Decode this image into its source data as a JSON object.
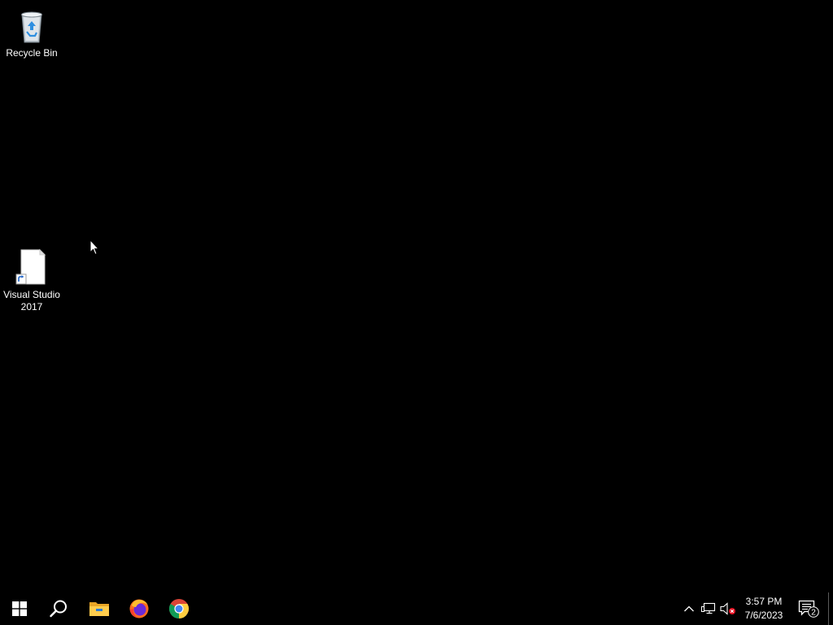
{
  "desktop": {
    "icons": [
      {
        "label": "Recycle Bin",
        "icon": "recycle-bin-icon"
      },
      {
        "label": "Visual Studio 2017",
        "icon": "file-shortcut-icon"
      }
    ]
  },
  "taskbar": {
    "pinned": [
      {
        "name": "Start",
        "icon": "windows-logo-icon"
      },
      {
        "name": "Search",
        "icon": "search-icon"
      },
      {
        "name": "File Explorer",
        "icon": "folder-icon"
      },
      {
        "name": "Firefox",
        "icon": "firefox-icon"
      },
      {
        "name": "Google Chrome",
        "icon": "chrome-icon"
      }
    ],
    "tray": {
      "icons": [
        "chevron-up-icon",
        "network-icon",
        "volume-muted-icon"
      ],
      "time": "3:57 PM",
      "date": "7/6/2023",
      "notification_count": "2"
    }
  },
  "colors": {
    "desktop_background": "#000000",
    "taskbar_background": "#000000",
    "text": "#ffffff"
  }
}
